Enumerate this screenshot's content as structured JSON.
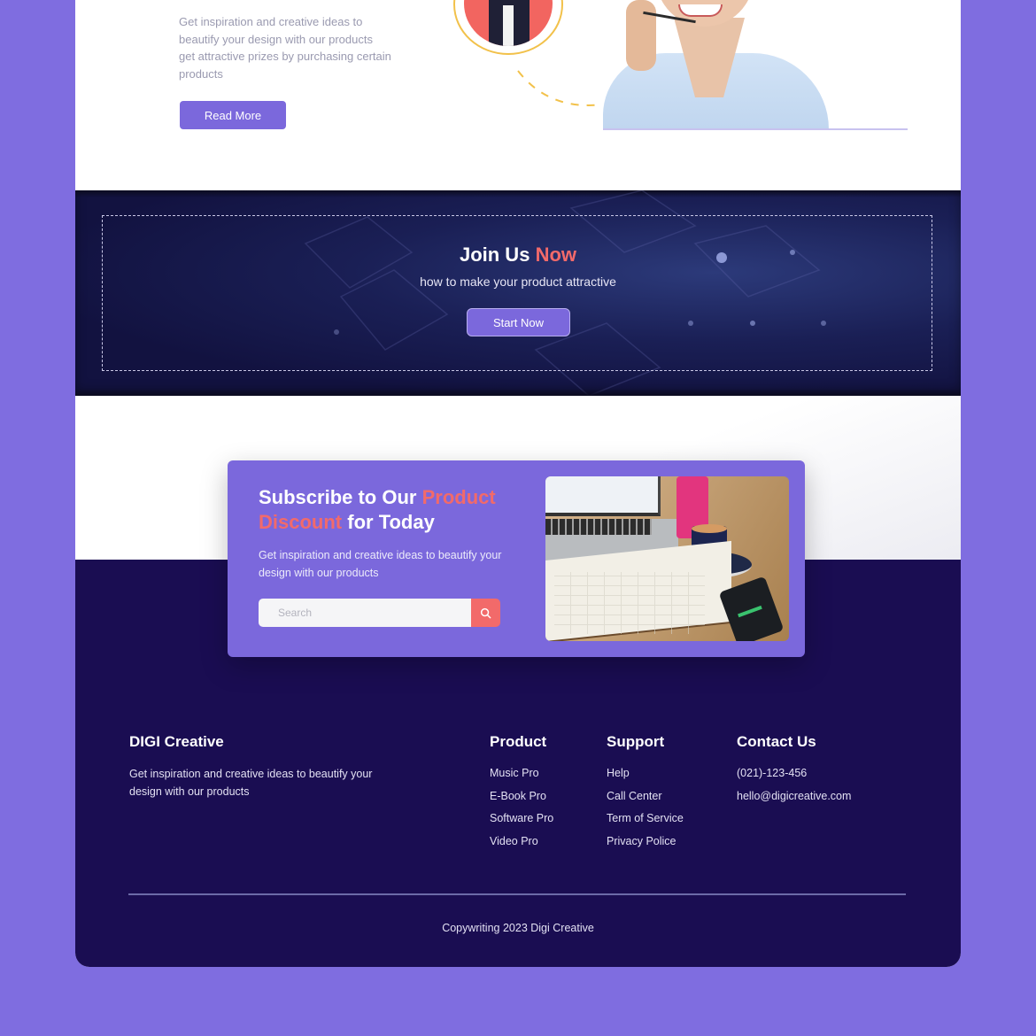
{
  "hero": {
    "description": "Get inspiration and creative ideas to beautify your design with our products get attractive prizes by purchasing certain products",
    "read_more_label": "Read More"
  },
  "join": {
    "title_main": "Join Us",
    "title_accent": "Now",
    "subtitle": "how to make your product attractive",
    "start_label": "Start Now"
  },
  "subscribe": {
    "title_part1": "Subscribe to Our",
    "title_accent1": "Product",
    "title_accent2": "Discount",
    "title_part2": "for Today",
    "description": "Get inspiration and creative ideas to beautify your design with our products",
    "search_placeholder": "Search",
    "search_value": "",
    "search_icon": "search-icon"
  },
  "footer": {
    "brand": "DIGI Creative",
    "description": "Get inspiration and creative ideas to beautify your design with our products",
    "columns": [
      {
        "title": "Product",
        "links": [
          "Music Pro",
          "E-Book Pro",
          "Software Pro",
          "Video Pro"
        ]
      },
      {
        "title": "Support",
        "links": [
          "Help",
          "Call Center",
          "Term of Service",
          "Privacy Police"
        ]
      },
      {
        "title": "Contact Us",
        "links": [
          "(021)-123-456",
          "hello@digicreative.com"
        ]
      }
    ],
    "copyright": "Copywriting 2023 Digi Creative"
  },
  "colors": {
    "background": "#7f6de0",
    "primary": "#7b68dc",
    "accent": "#f26a6a",
    "footer": "#1a0d52",
    "avatar_ring": "#f2c14a"
  }
}
